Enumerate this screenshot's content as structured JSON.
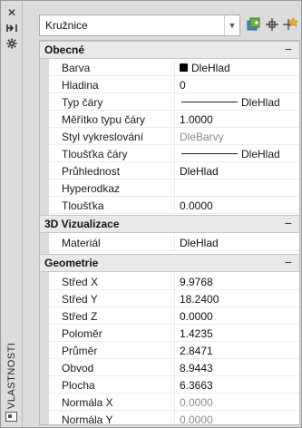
{
  "palette": {
    "title": "VLASTNOSTI",
    "close_icon": "close-icon",
    "autohide_icon": "autohide-icon",
    "settings_icon": "settings-icon"
  },
  "toolbar": {
    "object_type": "Kružnice",
    "dropdown_icon": "chevron-down-icon",
    "toggle_pickadd_icon": "pickadd-icon",
    "select_objects_icon": "select-objects-icon",
    "quick_select_icon": "quick-select-icon"
  },
  "sections": {
    "general": {
      "title": "Obecné",
      "toggle": "−",
      "rows": [
        {
          "label": "Barva",
          "value": "DleHlad"
        },
        {
          "label": "Hladina",
          "value": "0"
        },
        {
          "label": "Typ čáry",
          "value": "DleHlad"
        },
        {
          "label": "Měřítko typu čáry",
          "value": "1.0000"
        },
        {
          "label": "Styl vykreslování",
          "value": "DleBarvy"
        },
        {
          "label": "Tloušťka čáry",
          "value": "DleHlad"
        },
        {
          "label": "Průhlednost",
          "value": "DleHlad"
        },
        {
          "label": "Hyperodkaz",
          "value": ""
        },
        {
          "label": "Tloušťka",
          "value": "0.0000"
        }
      ]
    },
    "visualization": {
      "title": "3D Vizualizace",
      "toggle": "−",
      "rows": [
        {
          "label": "Materiál",
          "value": "DleHlad"
        }
      ]
    },
    "geometry": {
      "title": "Geometrie",
      "toggle": "−",
      "rows": [
        {
          "label": "Střed X",
          "value": "9.9768"
        },
        {
          "label": "Střed Y",
          "value": "18.2400"
        },
        {
          "label": "Střed Z",
          "value": "0.0000"
        },
        {
          "label": "Poloměr",
          "value": "1.4235"
        },
        {
          "label": "Průměr",
          "value": "2.8471"
        },
        {
          "label": "Obvod",
          "value": "8.9443"
        },
        {
          "label": "Plocha",
          "value": "6.3663"
        },
        {
          "label": "Normála X",
          "value": "0.0000"
        },
        {
          "label": "Normála Y",
          "value": "0.0000"
        }
      ]
    }
  }
}
